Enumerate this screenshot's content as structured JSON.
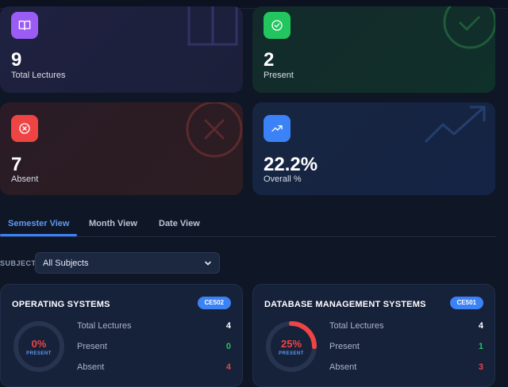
{
  "stats": {
    "lectures": {
      "value": "9",
      "label": "Total Lectures",
      "icon": "book-icon",
      "color": "#9b5cf6"
    },
    "present": {
      "value": "2",
      "label": "Present",
      "icon": "check-circle-icon",
      "color": "#22c55e"
    },
    "absent": {
      "value": "7",
      "label": "Absent",
      "icon": "x-circle-icon",
      "color": "#ef4444"
    },
    "overall": {
      "value": "22.2%",
      "label": "Overall %",
      "icon": "trending-up-icon",
      "color": "#3b82f6"
    }
  },
  "tabs": {
    "semester": "Semester View",
    "month": "Month View",
    "date": "Date View",
    "active": "semester"
  },
  "filter": {
    "label": "SUBJECT",
    "selected": "All Subjects"
  },
  "subjects": [
    {
      "title": "OPERATING SYSTEMS",
      "code": "CE502",
      "percent": "0%",
      "percent_value": 0,
      "percent_label": "PRESENT",
      "total_label": "Total Lectures",
      "total": "4",
      "present_label": "Present",
      "present": "0",
      "absent_label": "Absent",
      "absent": "4"
    },
    {
      "title": "DATABASE MANAGEMENT SYSTEMS",
      "code": "CE501",
      "percent": "25%",
      "percent_value": 25,
      "percent_label": "PRESENT",
      "total_label": "Total Lectures",
      "total": "4",
      "present_label": "Present",
      "present": "1",
      "absent_label": "Absent",
      "absent": "3"
    }
  ]
}
